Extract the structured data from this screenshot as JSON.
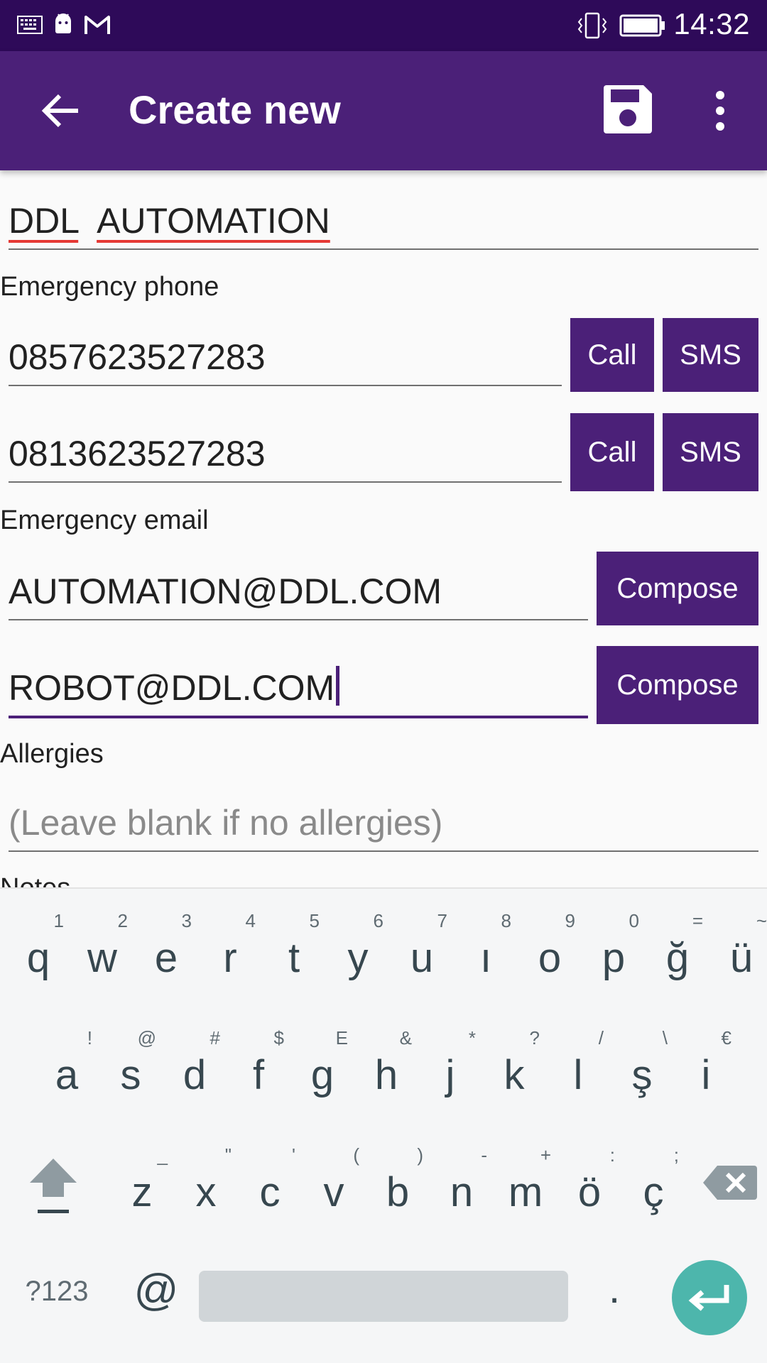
{
  "status_bar": {
    "time": "14:32",
    "icons": [
      "keyboard-icon",
      "android-icon",
      "gmail-icon",
      "vibrate-icon",
      "battery-icon"
    ]
  },
  "app_bar": {
    "title": "Create new",
    "icons": [
      "back-arrow-icon",
      "save-icon",
      "more-vert-icon"
    ]
  },
  "form": {
    "name": {
      "value": "DDL AUTOMATION",
      "words": [
        "DDL",
        "AUTOMATION"
      ]
    },
    "emergency_phone": {
      "label": "Emergency phone",
      "phones": [
        {
          "value": "0857623527283",
          "call_label": "Call",
          "sms_label": "SMS"
        },
        {
          "value": "0813623527283",
          "call_label": "Call",
          "sms_label": "SMS"
        }
      ]
    },
    "emergency_email": {
      "label": "Emergency email",
      "emails": [
        {
          "value": "AUTOMATION@DDL.COM",
          "compose_label": "Compose"
        },
        {
          "value": "ROBOT@DDL.COM",
          "compose_label": "Compose"
        }
      ]
    },
    "allergies": {
      "label": "Allergies",
      "placeholder": "(Leave blank if no allergies)"
    },
    "notes": {
      "label": "Notes"
    }
  },
  "keyboard": {
    "row1": [
      {
        "key": "q",
        "hint": "1"
      },
      {
        "key": "w",
        "hint": "2"
      },
      {
        "key": "e",
        "hint": "3"
      },
      {
        "key": "r",
        "hint": "4"
      },
      {
        "key": "t",
        "hint": "5"
      },
      {
        "key": "y",
        "hint": "6"
      },
      {
        "key": "u",
        "hint": "7"
      },
      {
        "key": "ı",
        "hint": "8"
      },
      {
        "key": "o",
        "hint": "9"
      },
      {
        "key": "p",
        "hint": "0"
      },
      {
        "key": "ğ",
        "hint": "="
      },
      {
        "key": "ü",
        "hint": "~"
      }
    ],
    "row2": [
      {
        "key": "a",
        "hint": "!"
      },
      {
        "key": "s",
        "hint": "@"
      },
      {
        "key": "d",
        "hint": "#"
      },
      {
        "key": "f",
        "hint": "$"
      },
      {
        "key": "g",
        "hint": "E"
      },
      {
        "key": "h",
        "hint": "&"
      },
      {
        "key": "j",
        "hint": "*"
      },
      {
        "key": "k",
        "hint": "?"
      },
      {
        "key": "l",
        "hint": "/"
      },
      {
        "key": "ş",
        "hint": "\\"
      },
      {
        "key": "i",
        "hint": "€"
      }
    ],
    "row3": [
      {
        "key": "z",
        "hint": "_"
      },
      {
        "key": "x",
        "hint": "\""
      },
      {
        "key": "c",
        "hint": "'"
      },
      {
        "key": "v",
        "hint": "("
      },
      {
        "key": "b",
        "hint": ")"
      },
      {
        "key": "n",
        "hint": "-"
      },
      {
        "key": "m",
        "hint": "+"
      },
      {
        "key": "ö",
        "hint": ":"
      },
      {
        "key": "ç",
        "hint": ";"
      }
    ],
    "symbols_label": "?123",
    "at_label": "@",
    "period_label": ".",
    "accent_color": "#4db6ac"
  },
  "colors": {
    "primary": "#4b2078",
    "status_bar": "#2e0a59",
    "spell_error": "#e53935"
  }
}
